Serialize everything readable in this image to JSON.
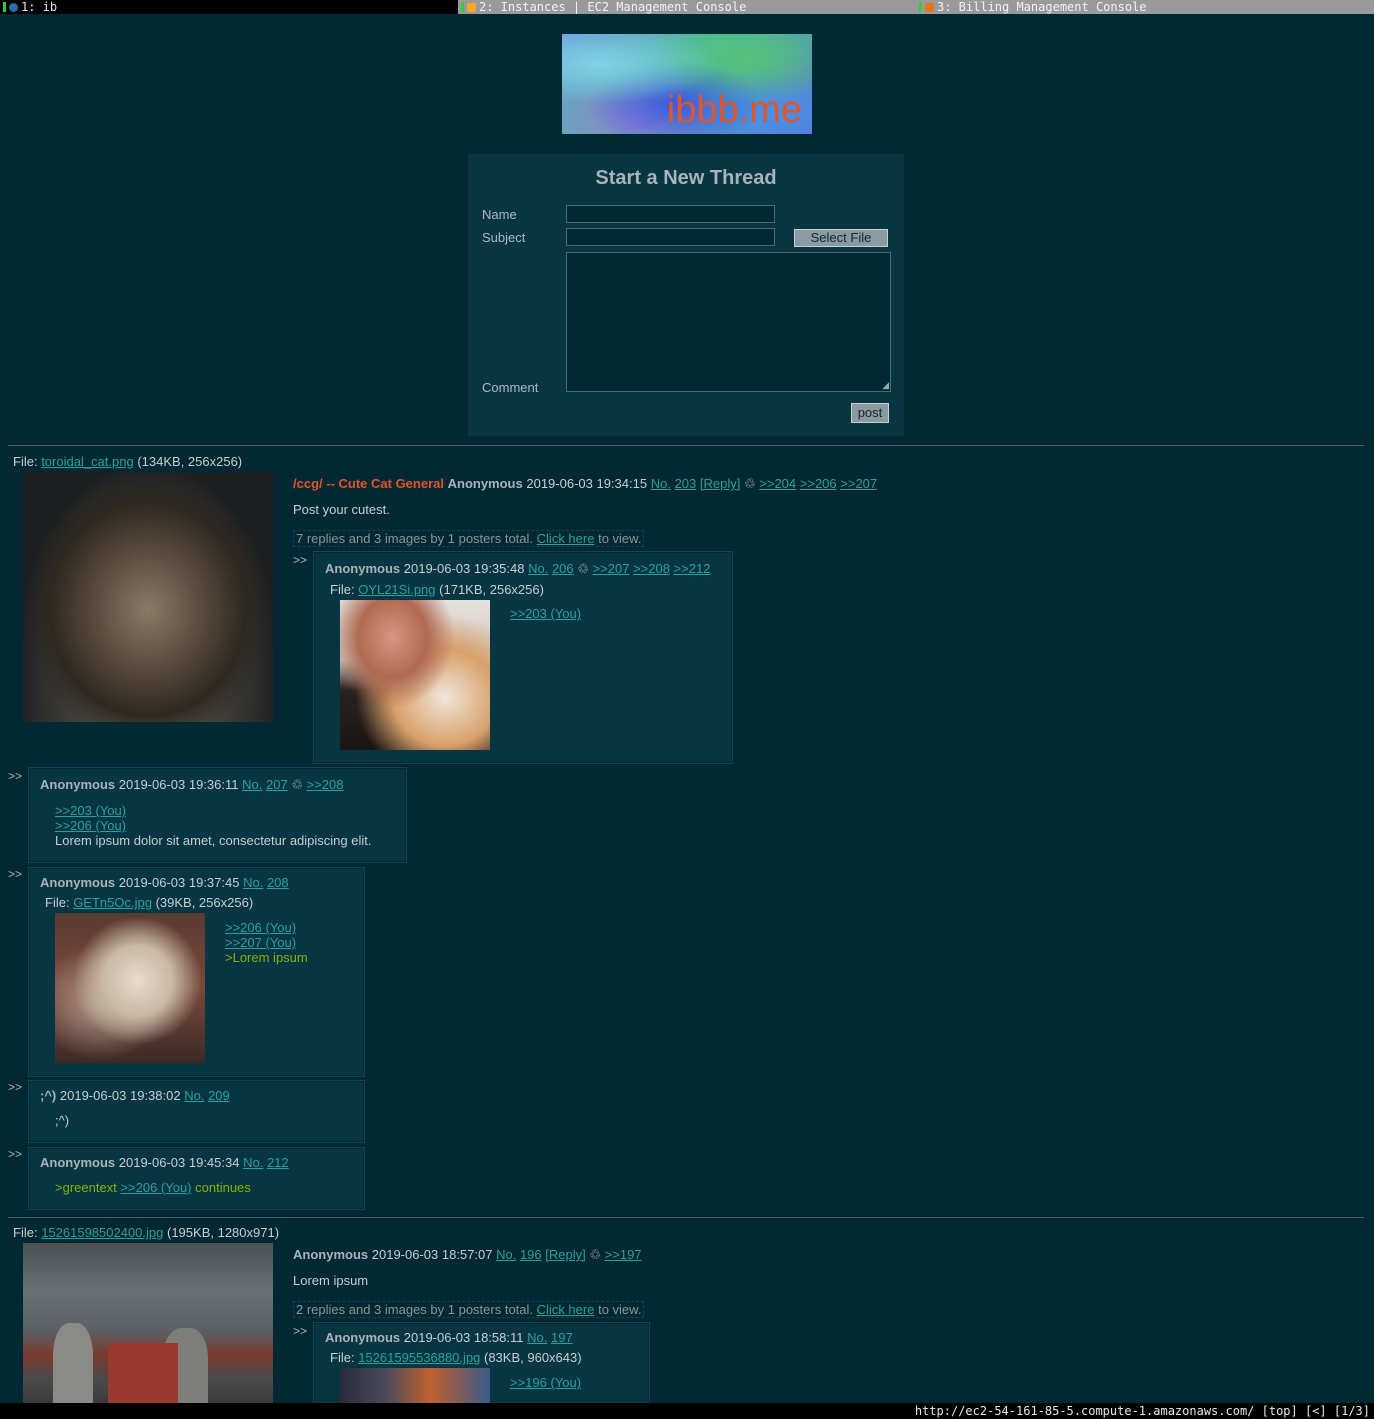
{
  "tabs": [
    {
      "label": "1: ib",
      "state": "active"
    },
    {
      "label": "2: Instances | EC2 Management Console",
      "state": "inactive"
    },
    {
      "label": "3: Billing Management Console",
      "state": "inactive"
    }
  ],
  "banner": {
    "text": "ibbb.me"
  },
  "form": {
    "title": "Start a New Thread",
    "name_label": "Name",
    "subject_label": "Subject",
    "comment_label": "Comment",
    "file_button": "Select File",
    "post_button": "post"
  },
  "thread1": {
    "file_label": "File:",
    "file_name": "toroidal_cat.png",
    "file_meta": "(134KB, 256x256)",
    "subject": "/ccg/ -- Cute Cat General",
    "name": "Anonymous",
    "date": "2019-06-03 19:34:15",
    "no_label": "No.",
    "no": "203",
    "reply_link": "[Reply]",
    "backlinks": [
      ">>204",
      ">>206",
      ">>207"
    ],
    "comment": "Post your cutest.",
    "omitted_pre": "7 replies and 3 images by 1 posters total.",
    "omitted_link": "Click here",
    "omitted_post": "to view.",
    "replies": [
      {
        "name": "Anonymous",
        "date": "2019-06-03 19:35:48",
        "no_label": "No.",
        "no": "206",
        "backlinks": [
          ">>207",
          ">>208",
          ">>212"
        ],
        "file_label": "File:",
        "file_name": "OYL21Si.png",
        "file_meta": "(171KB, 256x256)",
        "quote1": ">>203 (You)"
      },
      {
        "name": "Anonymous",
        "date": "2019-06-03 19:36:11",
        "no_label": "No.",
        "no": "207",
        "backlinks": [
          ">>208"
        ],
        "quote1": ">>203 (You)",
        "quote2": ">>206 (You)",
        "text": "Lorem ipsum dolor sit amet, consectetur adipiscing elit."
      },
      {
        "name": "Anonymous",
        "date": "2019-06-03 19:37:45",
        "no_label": "No.",
        "no": "208",
        "file_label": "File:",
        "file_name": "GETn5Oc.jpg",
        "file_meta": "(39KB, 256x256)",
        "quote1": ">>206 (You)",
        "quote2": ">>207 (You)",
        "greentext": ">Lorem ipsum"
      },
      {
        "name": ";^)",
        "date": "2019-06-03 19:38:02",
        "no_label": "No.",
        "no": "209",
        "text": ";^)"
      },
      {
        "name": "Anonymous",
        "date": "2019-06-03 19:45:34",
        "no_label": "No.",
        "no": "212",
        "green_pre": ">greentext",
        "quote1": ">>206 (You)",
        "green_post": "continues"
      }
    ]
  },
  "thread2": {
    "file_label": "File:",
    "file_name": "15261598502400.jpg",
    "file_meta": "(195KB, 1280x971)",
    "name": "Anonymous",
    "date": "2019-06-03 18:57:07",
    "no_label": "No.",
    "no": "196",
    "reply_link": "[Reply]",
    "backlinks": [
      ">>197"
    ],
    "comment": "Lorem ipsum",
    "omitted_pre": "2 replies and 3 images by 1 posters total.",
    "omitted_link": "Click here",
    "omitted_post": "to view.",
    "reply": {
      "name": "Anonymous",
      "date": "2019-06-03 18:58:11",
      "no_label": "No.",
      "no": "197",
      "file_label": "File:",
      "file_name": "15261595536880.jpg",
      "file_meta": "(83KB, 960x643)",
      "quote1": ">>196 (You)"
    }
  },
  "reply_arrow": ">>",
  "statusbar": {
    "text": "http://ec2-54-161-85-5.compute-1.amazonaws.com/ [top] [<] [1/3]"
  },
  "colors": {
    "background": "#022833",
    "panel": "#073642",
    "link": "#2aa198",
    "subject": "#e0562a",
    "greentext": "#85b300"
  }
}
